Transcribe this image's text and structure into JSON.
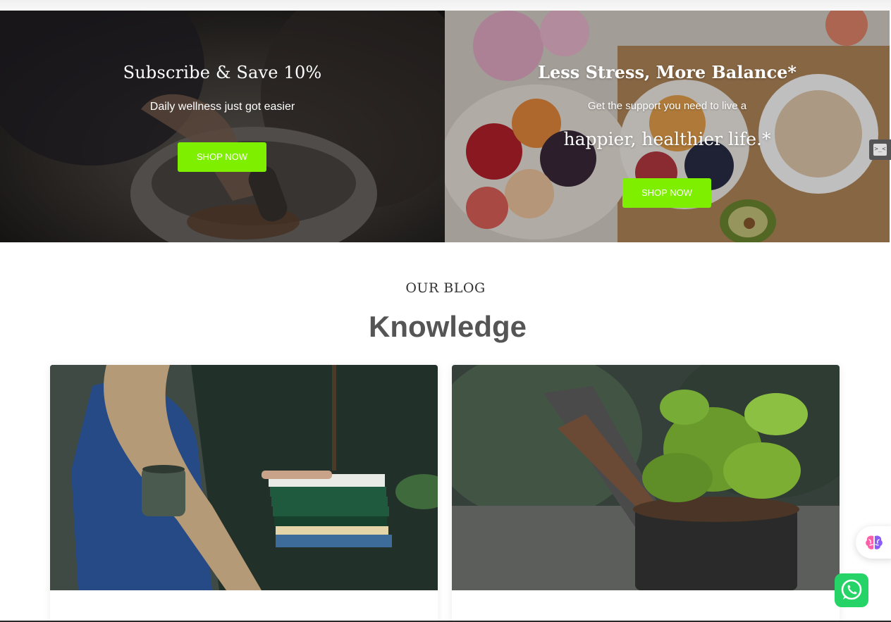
{
  "banners": {
    "left": {
      "title": "Subscribe & Save 10%",
      "subtitle": "Daily wellness just got easier",
      "button_label": "SHOP NOW"
    },
    "right": {
      "title": "Less Stress, More Balance*",
      "subtitle": "Get the support you need to live a",
      "subtitle2": "happier, healthier life.*",
      "button_label": "SHOP NOW"
    }
  },
  "blog": {
    "eyebrow": "OUR BLOG",
    "title": "Knowledge",
    "cards": [
      {
        "image_icon": "herbal-books-photo"
      },
      {
        "image_icon": "potted-plant-photo"
      }
    ]
  },
  "widgets": {
    "side_tab_icon": "code-icon",
    "brain_icon": "brain-icon",
    "whatsapp_icon": "whatsapp-icon"
  },
  "colors": {
    "accent": "#7fef00",
    "whatsapp": "#25d366",
    "heading": "#555555"
  }
}
